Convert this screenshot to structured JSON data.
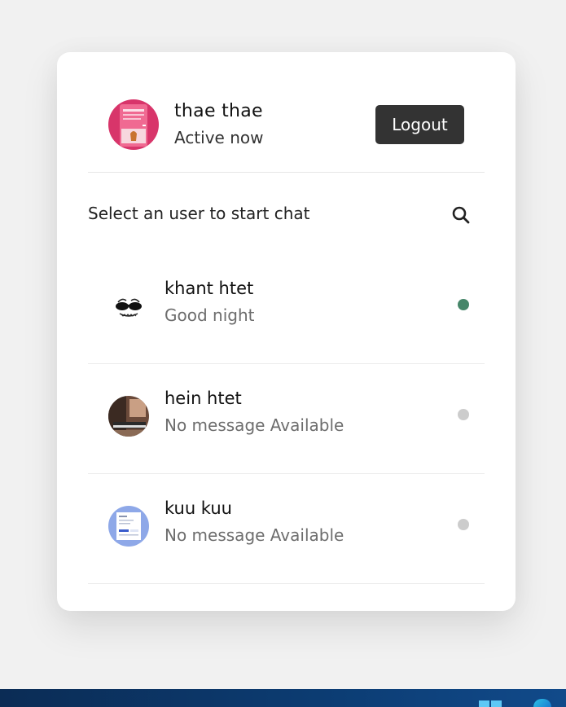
{
  "me": {
    "name": "thae thae",
    "status": "Active now",
    "logout_label": "Logout"
  },
  "search": {
    "text": "Select an user to start chat",
    "icon": "search-icon"
  },
  "users": [
    {
      "name": "khant htet",
      "message": "Good night",
      "online": true,
      "status_color": "#468669"
    },
    {
      "name": "hein htet",
      "message": "No message Available",
      "online": false,
      "status_color": "#cccccc"
    },
    {
      "name": "kuu kuu",
      "message": "No message Available",
      "online": false,
      "status_color": "#cccccc"
    }
  ],
  "colors": {
    "background": "#f1f1f1",
    "card": "#ffffff",
    "button": "#333333",
    "online": "#468669",
    "offline": "#cccccc"
  }
}
